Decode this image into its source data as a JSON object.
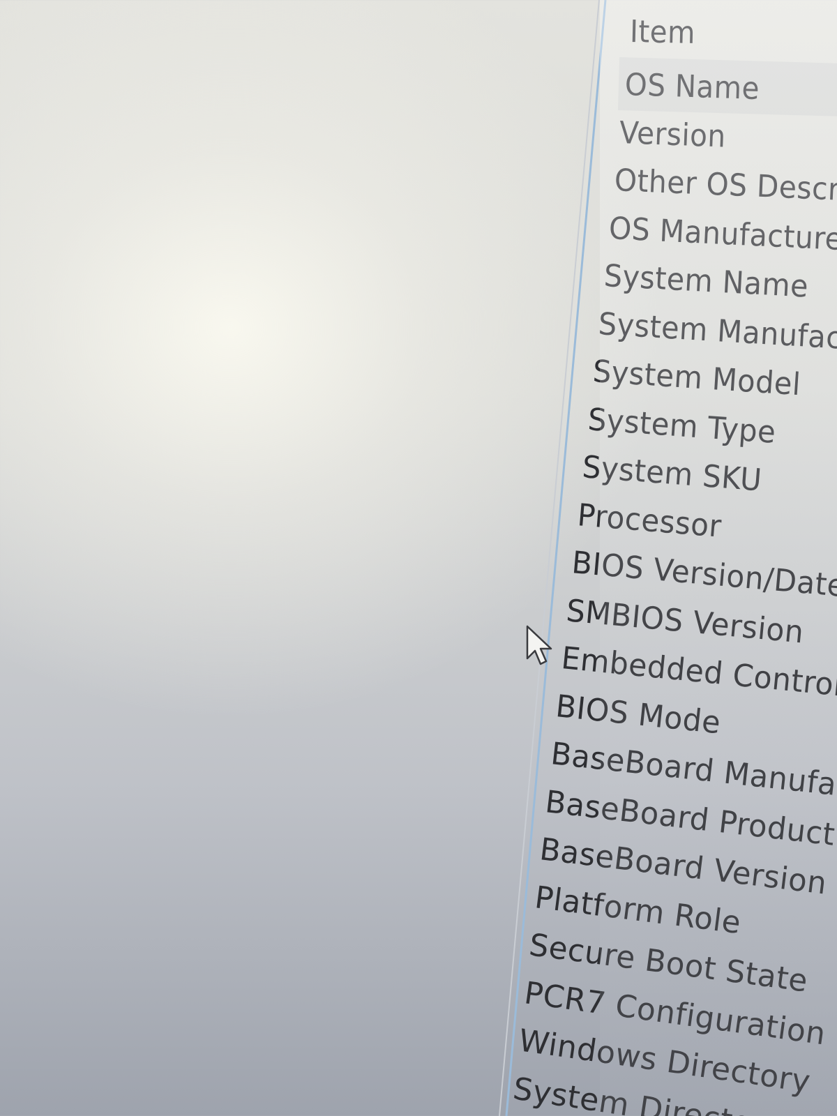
{
  "column_header": "Item",
  "items": [
    "OS Name",
    "Version",
    "Other OS Descr",
    "OS Manufacture",
    "System Name",
    "System Manufact",
    "System Model",
    "System Type",
    "System SKU",
    "Processor",
    "BIOS Version/Date",
    "SMBIOS Version",
    "Embedded Controlle",
    "BIOS Mode",
    "BaseBoard Manufactu",
    "BaseBoard Product",
    "BaseBoard Version",
    "Platform Role",
    "Secure Boot State",
    "PCR7 Configuration",
    "Windows Directory",
    "System Directory"
  ],
  "selected_item": "OS Name",
  "icons": {
    "cursor": "mouse-pointer-icon"
  },
  "colors": {
    "text": "#2e2f33",
    "splitter": "#8fb3d6",
    "row_highlight": "#c8cacd"
  }
}
